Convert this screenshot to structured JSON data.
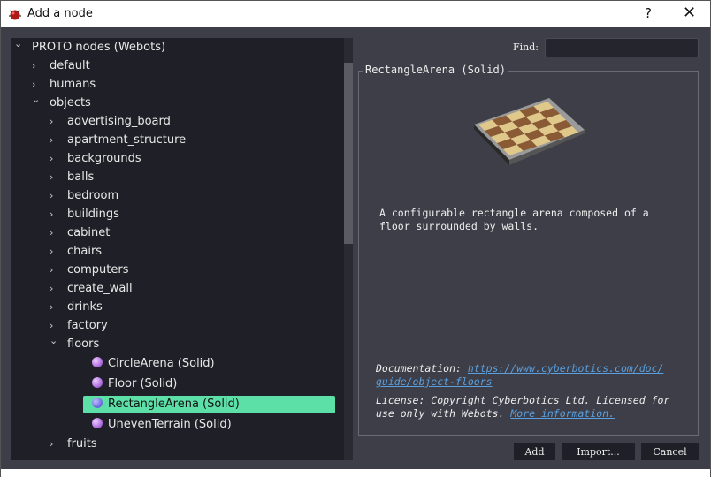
{
  "window": {
    "title": "Add a node",
    "help": "?",
    "close": "✕"
  },
  "tree": {
    "root": "PROTO nodes (Webots)",
    "top": [
      "default",
      "humans"
    ],
    "objects": "objects",
    "object_children": [
      "advertising_board",
      "apartment_structure",
      "backgrounds",
      "balls",
      "bedroom",
      "buildings",
      "cabinet",
      "chairs",
      "computers",
      "create_wall",
      "drinks",
      "factory"
    ],
    "floors": "floors",
    "floor_items": [
      "CircleArena (Solid)",
      "Floor (Solid)",
      "RectangleArena (Solid)",
      "UnevenTerrain (Solid)"
    ],
    "selected": "RectangleArena (Solid)",
    "after": [
      "fruits"
    ]
  },
  "find": {
    "label": "Find:",
    "value": ""
  },
  "details": {
    "title": "RectangleArena (Solid)",
    "description_1": "A configurable rectangle arena composed of a",
    "description_2": "floor surrounded by walls.",
    "doc_label": "Documentation:",
    "doc_link_1": "https://www.cyberbotics.com/doc/",
    "doc_link_2": "guide/object-floors",
    "license_1": "License: Copyright Cyberbotics Ltd. Licensed for",
    "license_2": "use only with Webots.",
    "license_link": "More information."
  },
  "buttons": {
    "add": "Add",
    "import": "Import...",
    "cancel": "Cancel"
  },
  "colors": {
    "selection": "#5ce0a8",
    "link": "#5aa0e0"
  }
}
